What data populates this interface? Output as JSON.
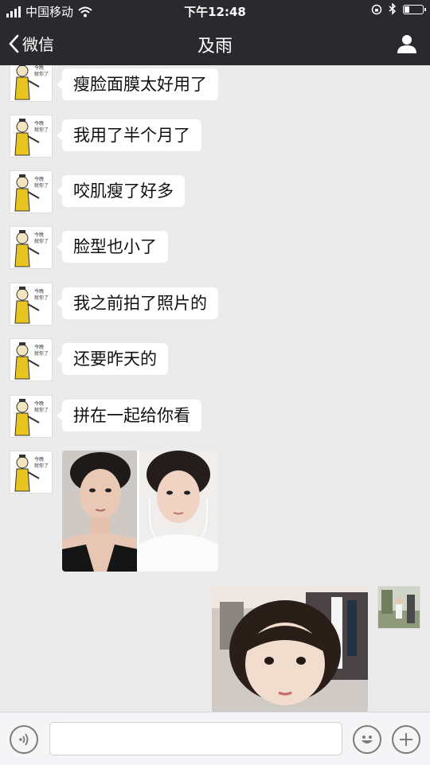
{
  "status_bar": {
    "carrier": "中国移动",
    "time": "下午12:48",
    "battery_level": 0.25
  },
  "nav": {
    "back_label": "微信",
    "title": "及雨"
  },
  "messages": [
    {
      "sender": "contact",
      "type": "text",
      "text": "瘦脸面膜太好用了"
    },
    {
      "sender": "contact",
      "type": "text",
      "text": "我用了半个月了"
    },
    {
      "sender": "contact",
      "type": "text",
      "text": "咬肌瘦了好多"
    },
    {
      "sender": "contact",
      "type": "text",
      "text": "脸型也小了"
    },
    {
      "sender": "contact",
      "type": "text",
      "text": "我之前拍了照片的"
    },
    {
      "sender": "contact",
      "type": "text",
      "text": "还要昨天的"
    },
    {
      "sender": "contact",
      "type": "text",
      "text": "拼在一起给你看"
    },
    {
      "sender": "contact",
      "type": "image",
      "description_icon": "before-after-photo"
    },
    {
      "sender": "self",
      "type": "image",
      "description_icon": "child-selfie-photo"
    }
  ],
  "colors": {
    "bar_bg": "#2a2a2e",
    "chat_bg": "#ebebeb",
    "bubble_bg": "#ffffff",
    "input_bg": "#f5f5f7"
  },
  "icons": {
    "back": "chevron-left-icon",
    "profile": "person-icon",
    "voice": "voice-icon",
    "emoji": "smiley-icon",
    "more": "plus-icon"
  }
}
